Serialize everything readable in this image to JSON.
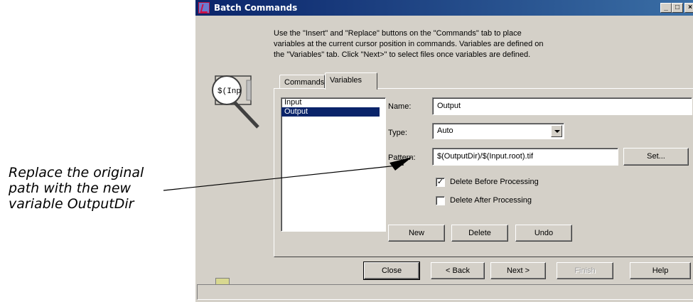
{
  "callout": {
    "line1": "Replace the original",
    "line2": "path with the new",
    "line3": "variable OutputDir"
  },
  "window": {
    "title": "Batch Commands",
    "minimize": "_",
    "maximize": "□",
    "close": "×"
  },
  "description": {
    "line1": "Use the \"Insert\" and \"Replace\" buttons on the \"Commands\" tab to place",
    "line2": "variables at the current cursor position in commands. Variables are defined on",
    "line3": "the \"Variables\" tab. Click \"Next>\" to select files once variables are defined."
  },
  "magnifier": {
    "text": "$(Inp"
  },
  "tabs": [
    {
      "label": "Commands",
      "active": false
    },
    {
      "label": "Variables",
      "active": true
    }
  ],
  "variables": {
    "list": [
      "Input",
      "Output"
    ],
    "selected": "Output",
    "name_label": "Name:",
    "name_value": "Output",
    "type_label": "Type:",
    "type_value": "Auto",
    "pattern_label": "Pattern:",
    "pattern_value": "$(OutputDir)/$(Input.root).tif",
    "set_button": "Set...",
    "delete_before_label": "Delete Before Processing",
    "delete_before_checked": true,
    "delete_after_label": "Delete After Processing",
    "delete_after_checked": false,
    "new_button": "New",
    "delete_button": "Delete",
    "undo_button": "Undo"
  },
  "footer": {
    "close": "Close",
    "back": "< Back",
    "next": "Next >",
    "finish": "Finish",
    "help": "Help"
  },
  "colors": {
    "title_start": "#0a246a",
    "title_end": "#3a6ea5",
    "face": "#d4d0c8",
    "selection": "#0a246a",
    "indicator": "#d8d890"
  }
}
